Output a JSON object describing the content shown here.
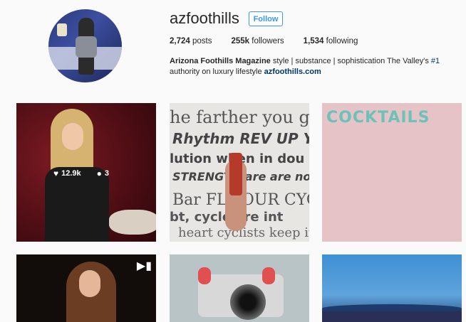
{
  "profile": {
    "username": "azfoothills",
    "follow_label": "Follow",
    "stats": {
      "posts_count": "2,724",
      "posts_label": "posts",
      "followers_count": "255k",
      "followers_label": "followers",
      "following_count": "1,534",
      "following_label": "following"
    },
    "bio": {
      "name": "Arizona Foothills Magazine",
      "text1": " style | substance | sophistication The Valley's ",
      "tag": "#1",
      "text2": "authority on luxury lifestyle ",
      "link": "azfoothills.com"
    }
  },
  "posts": [
    {
      "likes": "12.9k",
      "comments": "3",
      "hover": true
    },
    {
      "lines": [
        "he farther you g",
        "Rhythm REV UP YOU",
        "lution when in dou",
        "STRENGTH are are no sh",
        "Bar FLY OUR CYCLE",
        "bt, cycle are int",
        "heart cyclists keep it"
      ]
    },
    {
      "sign": "COCKTAILS"
    },
    {
      "video": true
    },
    {},
    {}
  ],
  "colors": {
    "accent": "#3897f0",
    "link": "#003569"
  }
}
